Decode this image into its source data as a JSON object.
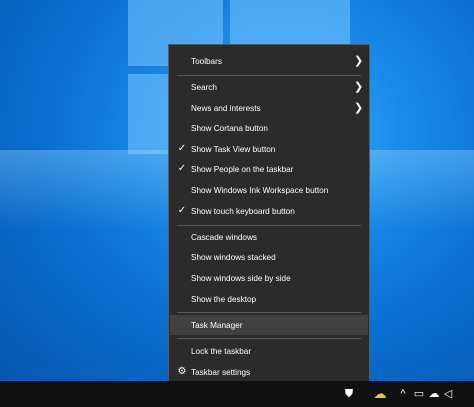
{
  "menu": {
    "toolbars": "Toolbars",
    "search": "Search",
    "news": "News and interests",
    "cortana": "Show Cortana button",
    "task_view": "Show Task View button",
    "people": "Show People on the taskbar",
    "ink": "Show Windows Ink Workspace button",
    "touch_keyboard": "Show touch keyboard button",
    "cascade": "Cascade windows",
    "stacked": "Show windows stacked",
    "side_by_side": "Show windows side by side",
    "desktop": "Show the desktop",
    "task_manager": "Task Manager",
    "lock": "Lock the taskbar",
    "settings": "Taskbar settings"
  },
  "icons": {
    "check": "✓",
    "arrow": "❯",
    "gear": "⚙",
    "people": "⛊",
    "weather": "☁",
    "chevron_up": "^",
    "network": "▭",
    "cloud": "☁",
    "volume": "◁"
  }
}
